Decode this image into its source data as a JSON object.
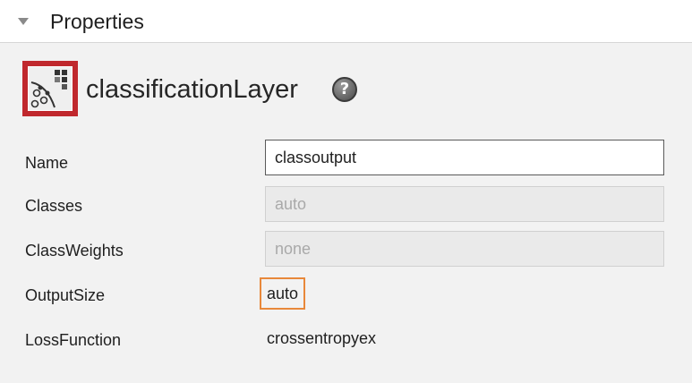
{
  "header": {
    "title": "Properties"
  },
  "layer": {
    "title": "classificationLayer",
    "help_glyph": "?"
  },
  "properties": {
    "name": {
      "label": "Name",
      "value": "classoutput"
    },
    "classes": {
      "label": "Classes",
      "value": "auto"
    },
    "class_weights": {
      "label": "ClassWeights",
      "value": "none"
    },
    "output_size": {
      "label": "OutputSize",
      "value": "auto"
    },
    "loss_function": {
      "label": "LossFunction",
      "value": "crossentropyex"
    }
  },
  "icons": {
    "collapse": "triangle-down-icon",
    "layer": "classification-layer-icon",
    "help": "help-icon"
  },
  "colors": {
    "layer_icon_bg": "#c0282d",
    "highlight_border": "#e8883a",
    "panel_bg": "#f2f2f2"
  }
}
